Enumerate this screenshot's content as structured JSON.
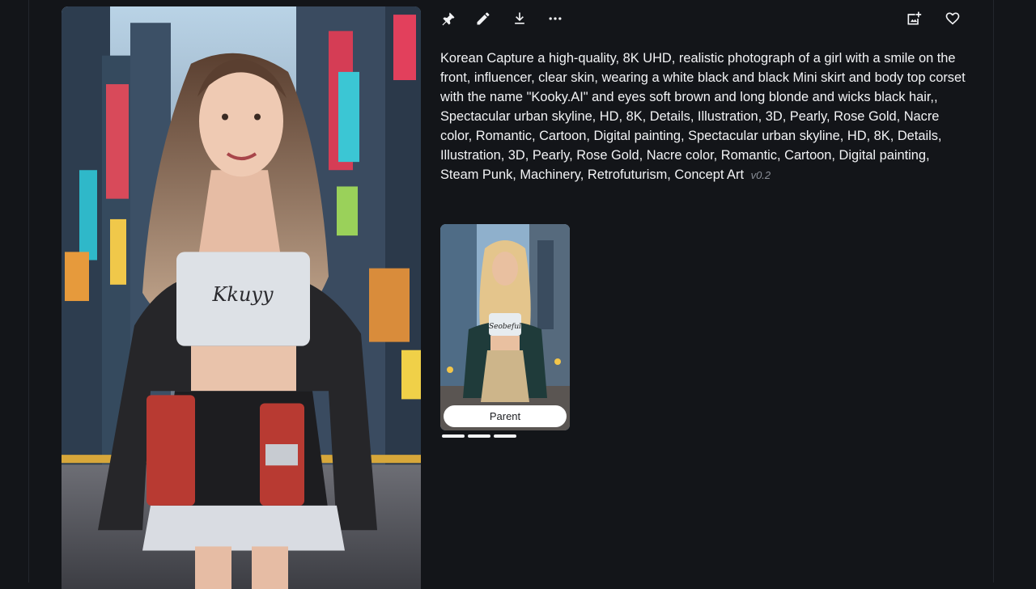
{
  "toolbar": {
    "left_icons": [
      "pin-icon",
      "edit-icon",
      "download-icon",
      "more-icon"
    ],
    "right_icons": [
      "add-image-icon",
      "heart-icon"
    ]
  },
  "prompt": {
    "text": "Korean Capture a high-quality, 8K UHD, realistic photograph of a girl with a smile on the front, influencer, clear skin, wearing a white black and black Mini skirt and body top corset with the name \"Kooky.AI\" and eyes soft brown and long blonde and wicks black hair,, Spectacular urban skyline, HD, 8K, Details, Illustration, 3D, Pearly, Rose Gold, Nacre color, Romantic, Cartoon, Digital painting, Spectacular urban skyline, HD, 8K, Details, Illustration, 3D, Pearly, Rose Gold, Nacre color, Romantic, Cartoon, Digital painting, Steam Punk, Machinery, Retrofuturism, Concept Art",
    "version": "v0.2"
  },
  "main_image": {
    "shirt_text": "Kkuyy"
  },
  "parent": {
    "button_label": "Parent",
    "shirt_text": "Seobeful",
    "page_dots": 3
  },
  "colors": {
    "background": "#131519",
    "text": "#f2f3f5",
    "muted": "#8a8f98",
    "button_bg": "#ffffff"
  }
}
